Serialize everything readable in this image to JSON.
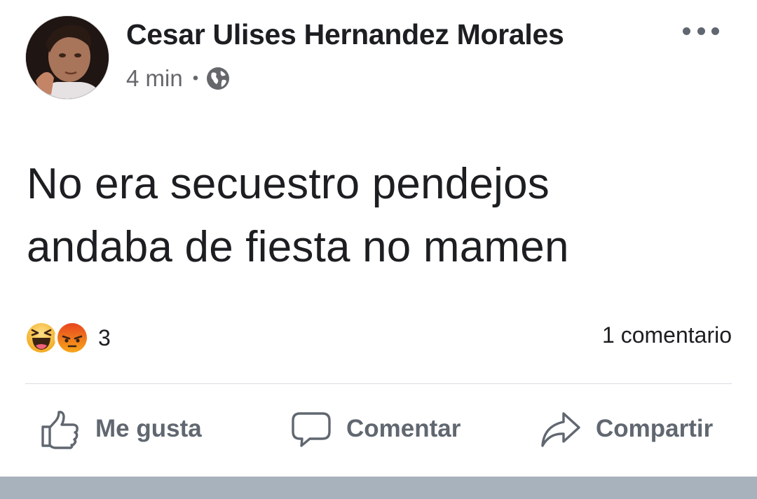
{
  "post": {
    "author": "Cesar Ulises Hernandez Morales",
    "time": "4 min",
    "separator": "•",
    "privacy_icon": "globe-icon",
    "text_line1": "No era secuestro pendejos",
    "text_line2": "andaba de fiesta no mamen",
    "reactions": {
      "icons": [
        "laughing-haha-icon",
        "angry-icon"
      ],
      "count": "3"
    },
    "comments": "1 comentario"
  },
  "actions": {
    "like": {
      "label": "Me gusta",
      "icon": "thumbs-up-icon"
    },
    "comment": {
      "label": "Comentar",
      "icon": "comment-bubble-icon"
    },
    "share": {
      "label": "Compartir",
      "icon": "share-arrow-icon"
    }
  },
  "colors": {
    "text": "#1c1e21",
    "secondary": "#65676b",
    "action": "#606770",
    "haha": "#f7b125",
    "angry": "#e9710f",
    "bottom_bar": "#a8b2bc"
  }
}
